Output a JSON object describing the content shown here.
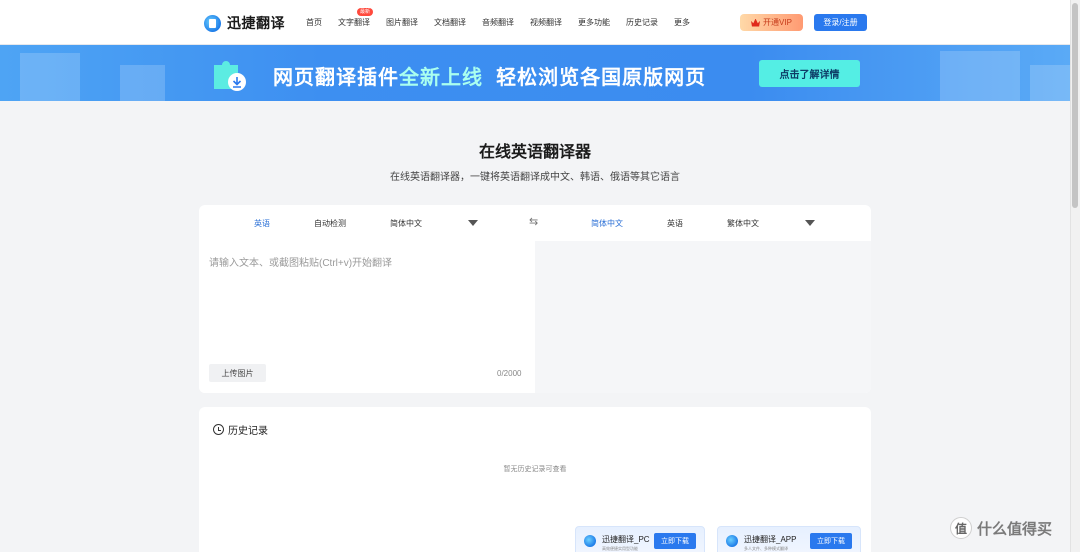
{
  "header": {
    "brand": "迅捷翻译",
    "nav": [
      {
        "label": "首页"
      },
      {
        "label": "文字翻译",
        "badge": "最新"
      },
      {
        "label": "图片翻译"
      },
      {
        "label": "文档翻译"
      },
      {
        "label": "音频翻译"
      },
      {
        "label": "视频翻译"
      },
      {
        "label": "更多功能"
      },
      {
        "label": "历史记录"
      },
      {
        "label": "更多"
      }
    ],
    "vip_label": "开通VIP",
    "login_label": "登录/注册"
  },
  "banner": {
    "text_part1": "网页翻译插件",
    "text_highlight": "全新上线",
    "text_part2": "轻松浏览各国原版网页",
    "button": "点击了解详情"
  },
  "title": "在线英语翻译器",
  "subtitle": "在线英语翻译器，一键将英语翻译成中文、韩语、俄语等其它语言",
  "translator": {
    "source_langs": [
      "英语",
      "自动检测",
      "简体中文"
    ],
    "target_langs": [
      "简体中文",
      "英语",
      "繁体中文"
    ],
    "placeholder": "请输入文本、或截图粘贴(Ctrl+v)开始翻译",
    "input_value": "",
    "upload_label": "上传图片",
    "counter": "0/2000"
  },
  "history": {
    "title": "历史记录",
    "empty": "暂无历史记录可查看",
    "apps": [
      {
        "name": "迅捷翻译_PC",
        "desc": "高效便捷实用型功能",
        "download": "立即下载"
      },
      {
        "name": "迅捷翻译_APP",
        "desc": "多人文件、多种模式翻译",
        "download": "立即下载"
      }
    ]
  },
  "watermark": {
    "symbol": "值",
    "text": "什么值得买"
  },
  "colors": {
    "primary": "#2a79ee",
    "banner": "#3d8ff1",
    "accent_button": "#54eee4",
    "badge": "#ff4a3d"
  }
}
